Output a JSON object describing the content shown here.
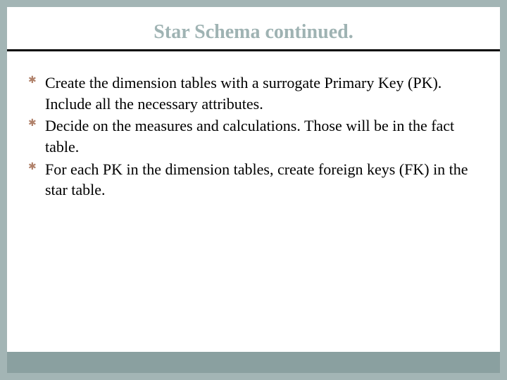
{
  "slide": {
    "title": "Star Schema continued.",
    "bullets": [
      "Create the dimension tables with a surrogate Primary Key (PK).  Include all the necessary attributes.",
      "Decide on the measures and calculations. Those will be in the fact table.",
      "For each PK in the dimension tables, create foreign keys (FK) in the star table."
    ]
  }
}
